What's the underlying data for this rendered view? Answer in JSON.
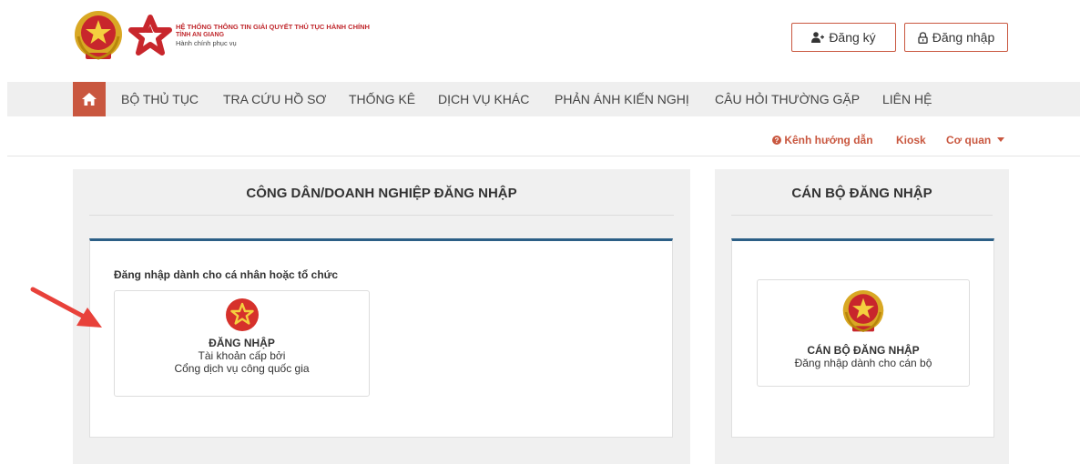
{
  "header": {
    "logo_line1": "HỆ THỐNG THÔNG TIN GIẢI QUYẾT THỦ TỤC HÀNH CHÍNH",
    "logo_line2": "TỈNH AN GIANG",
    "logo_line3": "Hành chính phục vụ",
    "register_label": "Đăng ký",
    "login_label": "Đăng nhập"
  },
  "nav": {
    "items": [
      {
        "label": "BỘ THỦ TỤC"
      },
      {
        "label": "TRA CỨU HỒ SƠ"
      },
      {
        "label": "THỐNG KÊ"
      },
      {
        "label": "DỊCH VỤ KHÁC"
      },
      {
        "label": "PHẢN ÁNH KIẾN NGHỊ"
      },
      {
        "label": "CÂU HỎI THƯỜNG GẶP"
      },
      {
        "label": "LIÊN HỆ"
      }
    ]
  },
  "toolbar": {
    "guide_label": "Kênh hướng dẫn",
    "kiosk_label": "Kiosk",
    "agency_label": "Cơ quan"
  },
  "citizen": {
    "title": "CÔNG DÂN/DOANH NGHIỆP ĐĂNG NHẬP",
    "subtitle": "Đăng nhập dành cho cá nhân hoặc tổ chức",
    "card_title": "ĐĂNG NHẬP",
    "card_line1": "Tài khoản cấp bởi",
    "card_line2": "Cổng dịch vụ công quốc gia"
  },
  "officer": {
    "title": "CÁN BỘ ĐĂNG NHẬP",
    "card_title": "CÁN BỘ ĐĂNG NHẬP",
    "card_line1": "Đăng nhập dành cho cán bộ"
  },
  "colors": {
    "accent": "#c9573f",
    "nav_bg": "#efefef",
    "panel_bg": "#f0f0f0",
    "inner_border": "#2c5f86",
    "arrow": "#e8413a"
  },
  "icons": [
    "national-emblem-icon",
    "star-logo-icon",
    "user-plus-icon",
    "lock-icon",
    "home-icon",
    "question-circle-icon",
    "caret-down-icon",
    "vndc-star-icon",
    "arrow-pointer-icon"
  ]
}
